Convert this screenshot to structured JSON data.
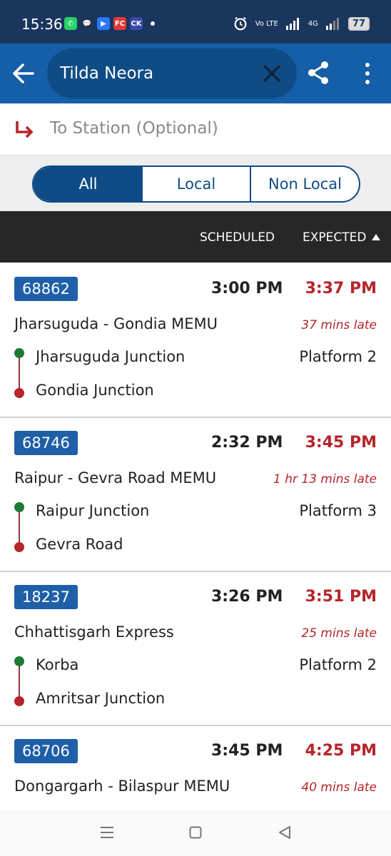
{
  "status_bar": {
    "time": "15:36",
    "app_icons": [
      {
        "name": "whatsapp-icon",
        "glyph": "✆",
        "color": "#25d366"
      },
      {
        "name": "message-icon",
        "glyph": "💬",
        "color": "#1b365d"
      },
      {
        "name": "play-icon",
        "glyph": "▶",
        "color": "#2979ff"
      },
      {
        "name": "fc-icon",
        "glyph": "FC",
        "color": "#e53935"
      },
      {
        "name": "ck-icon",
        "glyph": "CK",
        "color": "#3949ab"
      }
    ],
    "network": "Vo LTE",
    "network_type": "4G",
    "battery": "77"
  },
  "app_bar": {
    "search_value": "Tilda Neora"
  },
  "to_station": {
    "placeholder": "To Station (Optional)"
  },
  "filters": {
    "options": [
      "All",
      "Local",
      "Non Local"
    ],
    "selected": "All"
  },
  "columns": {
    "scheduled": "SCHEDULED",
    "expected": "EXPECTED"
  },
  "trains": [
    {
      "number": "68862",
      "scheduled": "3:00 PM",
      "expected": "3:37 PM",
      "name": "Jharsuguda - Gondia MEMU",
      "delay": "37 mins late",
      "from": "Jharsuguda Junction",
      "to": "Gondia Junction",
      "platform": "Platform 2"
    },
    {
      "number": "68746",
      "scheduled": "2:32 PM",
      "expected": "3:45 PM",
      "name": "Raipur - Gevra Road MEMU",
      "delay": "1 hr 13 mins late",
      "from": "Raipur Junction",
      "to": "Gevra Road",
      "platform": "Platform 3"
    },
    {
      "number": "18237",
      "scheduled": "3:26 PM",
      "expected": "3:51 PM",
      "name": "Chhattisgarh Express",
      "delay": "25 mins late",
      "from": "Korba",
      "to": "Amritsar Junction",
      "platform": "Platform 2"
    },
    {
      "number": "68706",
      "scheduled": "3:45 PM",
      "expected": "4:25 PM",
      "name": "Dongargarh - Bilaspur MEMU",
      "delay": "40 mins late",
      "from": "",
      "to": "",
      "platform": ""
    }
  ],
  "colors": {
    "primary": "#155ea8",
    "dark_primary": "#0f4c86",
    "late_red": "#b5252b",
    "origin_green": "#1e7b34"
  }
}
